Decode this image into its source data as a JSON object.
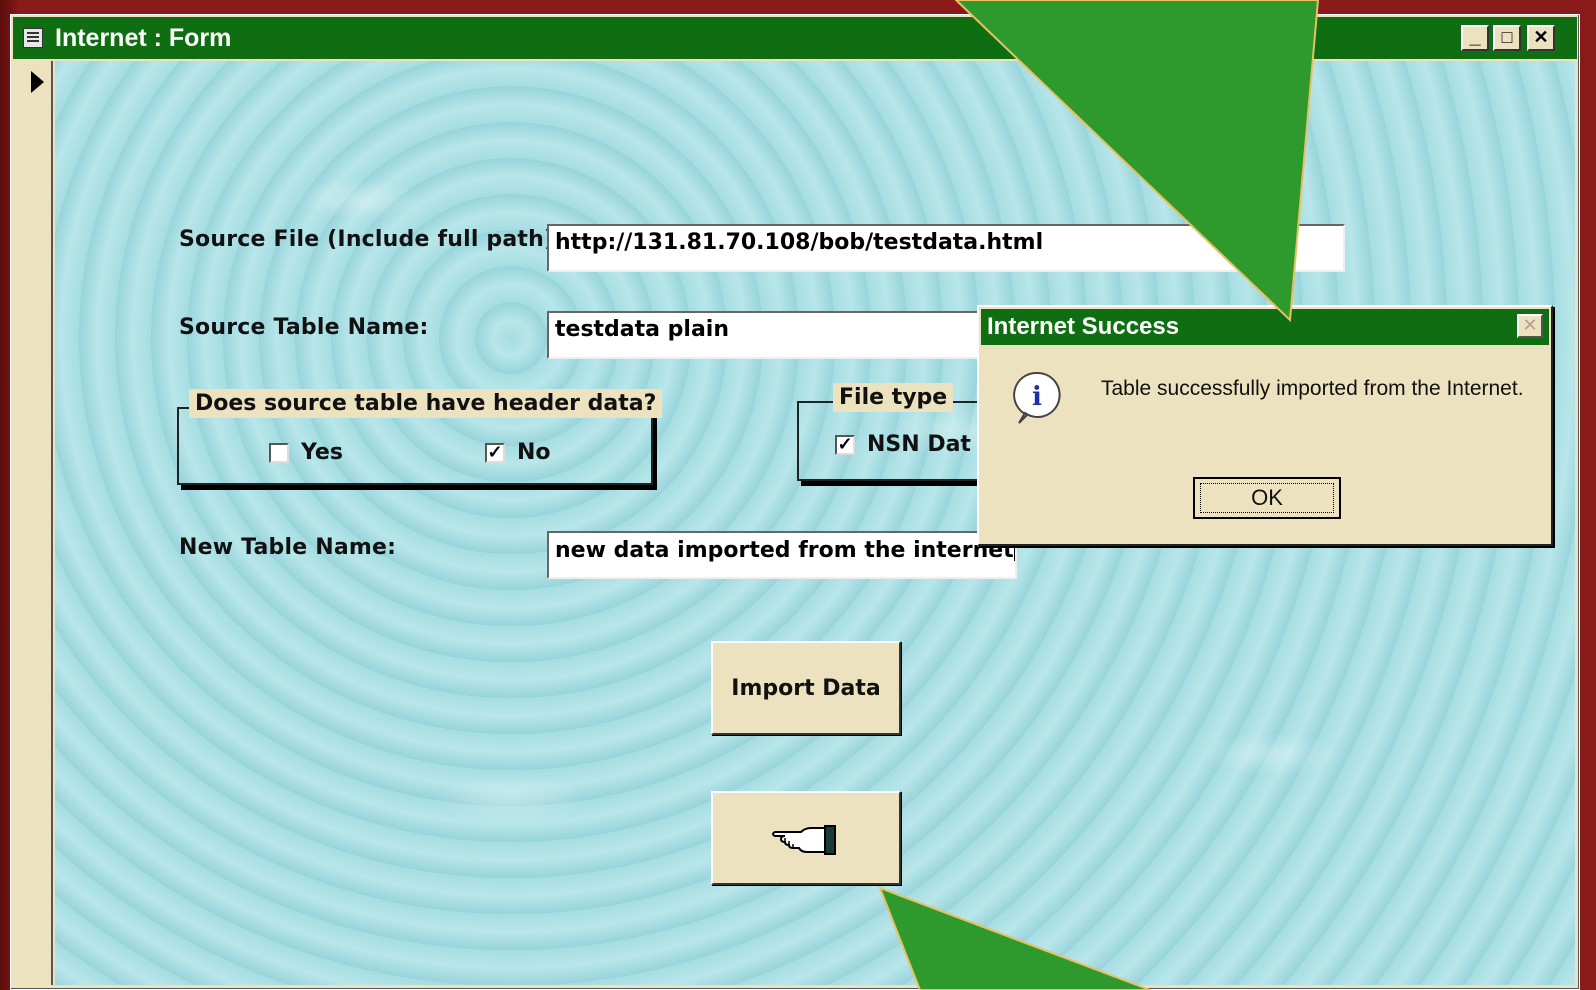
{
  "window": {
    "title": "Internet : Form",
    "controls": {
      "minimize": "_",
      "maximize": "□",
      "close": "✕"
    }
  },
  "form": {
    "source_file_label": "Source File (Include full path):",
    "source_file_value": "http://131.81.70.108/bob/testdata.html",
    "source_table_label": "Source Table Name:",
    "source_table_value": "testdata plain",
    "header_group_title": "Does source table have header data?",
    "header_yes_label": "Yes",
    "header_yes_checked": false,
    "header_no_label": "No",
    "header_no_checked": true,
    "file_type_title": "File type",
    "file_type_option_label": "NSN Dat",
    "file_type_option_checked": true,
    "new_table_label": "New Table Name:",
    "new_table_value": "new data imported from the internet",
    "import_button_label": "Import Data",
    "exit_button_icon": "pointing-hand-icon"
  },
  "dialog": {
    "title": "Internet Success",
    "message": "Table successfully imported from the Internet.",
    "ok_label": "OK",
    "icon": "info-icon"
  },
  "colors": {
    "titlebar": "#0f6e12",
    "window_face": "#ece2bf",
    "background_sky": "#a8dde2",
    "callout_green": "#2e9a2e",
    "callout_border": "#e8c060"
  }
}
